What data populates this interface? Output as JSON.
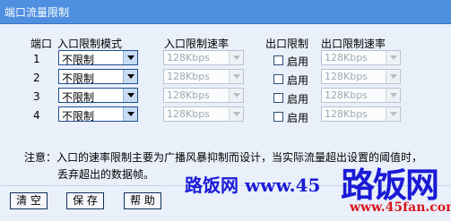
{
  "title": "端口流量限制",
  "headers": {
    "port": "端口",
    "inbound_mode": "入口限制模式",
    "inbound_rate": "入口限制速率",
    "outbound_limit": "出口限制",
    "outbound_rate": "出口限制速率"
  },
  "rows": [
    {
      "port": "1",
      "mode": "不限制",
      "in_rate": "128Kbps",
      "enable_label": "启用",
      "out_rate": "128Kbps"
    },
    {
      "port": "2",
      "mode": "不限制",
      "in_rate": "128Kbps",
      "enable_label": "启用",
      "out_rate": "128Kbps"
    },
    {
      "port": "3",
      "mode": "不限制",
      "in_rate": "128Kbps",
      "enable_label": "启用",
      "out_rate": "128Kbps"
    },
    {
      "port": "4",
      "mode": "不限制",
      "in_rate": "128Kbps",
      "enable_label": "启用",
      "out_rate": "128Kbps"
    }
  ],
  "note": {
    "line1": "注意：入口的速率限制主要为广播风暴抑制而设计，当实际流量超出设置的阈值时，",
    "line2": "丢弃超出的数据帧。"
  },
  "buttons": {
    "clear": "清 空",
    "save": "保 存",
    "help": "帮 助"
  },
  "watermark": {
    "text1": "路饭网 www.45",
    "big": "路饭网",
    "url": "www.45fan.com"
  },
  "colors": {
    "titlebar": "#4f8fe0",
    "panel": "#e9f0fa",
    "watermark_blue": "#1a1ad6",
    "watermark_red": "#d9141c"
  }
}
